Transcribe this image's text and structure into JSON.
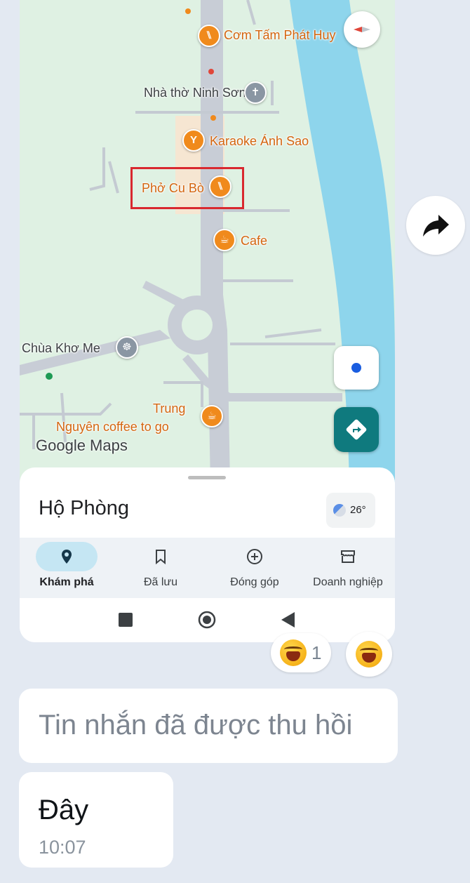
{
  "map": {
    "pois": {
      "com_tam": "Cơm Tấm Phát Huy",
      "nha_tho": "Nhà thờ Ninh Sơn",
      "karaoke": "Karaoke Ánh Sao",
      "pho": "Phở Cu Bò",
      "cafe": "Cafe",
      "chua": "Chùa Khơ Me",
      "trung_line1": "Trung",
      "trung_line2": "Nguyên coffee to go"
    },
    "logo": "Google Maps",
    "icons": {
      "compass": "compass-icon",
      "locate": "my-location-icon",
      "directions": "directions-icon"
    }
  },
  "sheet": {
    "place": "Hộ Phòng",
    "temperature": "26°"
  },
  "nav": {
    "items": [
      {
        "label": "Khám phá",
        "icon": "explore-pin-icon",
        "active": true
      },
      {
        "label": "Đã lưu",
        "icon": "bookmark-icon",
        "active": false
      },
      {
        "label": "Đóng góp",
        "icon": "add-circle-icon",
        "active": false
      },
      {
        "label": "Doanh nghiệp",
        "icon": "storefront-icon",
        "active": false
      }
    ]
  },
  "reactions": {
    "count": "1"
  },
  "messages": {
    "recalled": "Tin nhắn đã được thu hồi",
    "last_text": "Đây",
    "last_time": "10:07"
  },
  "colors": {
    "map_green": "#dff1e3",
    "river": "#8ed5ec",
    "accent_teal": "#0f7a7e",
    "highlight_red": "#d9282f",
    "chat_bg": "#e3e9f2"
  }
}
